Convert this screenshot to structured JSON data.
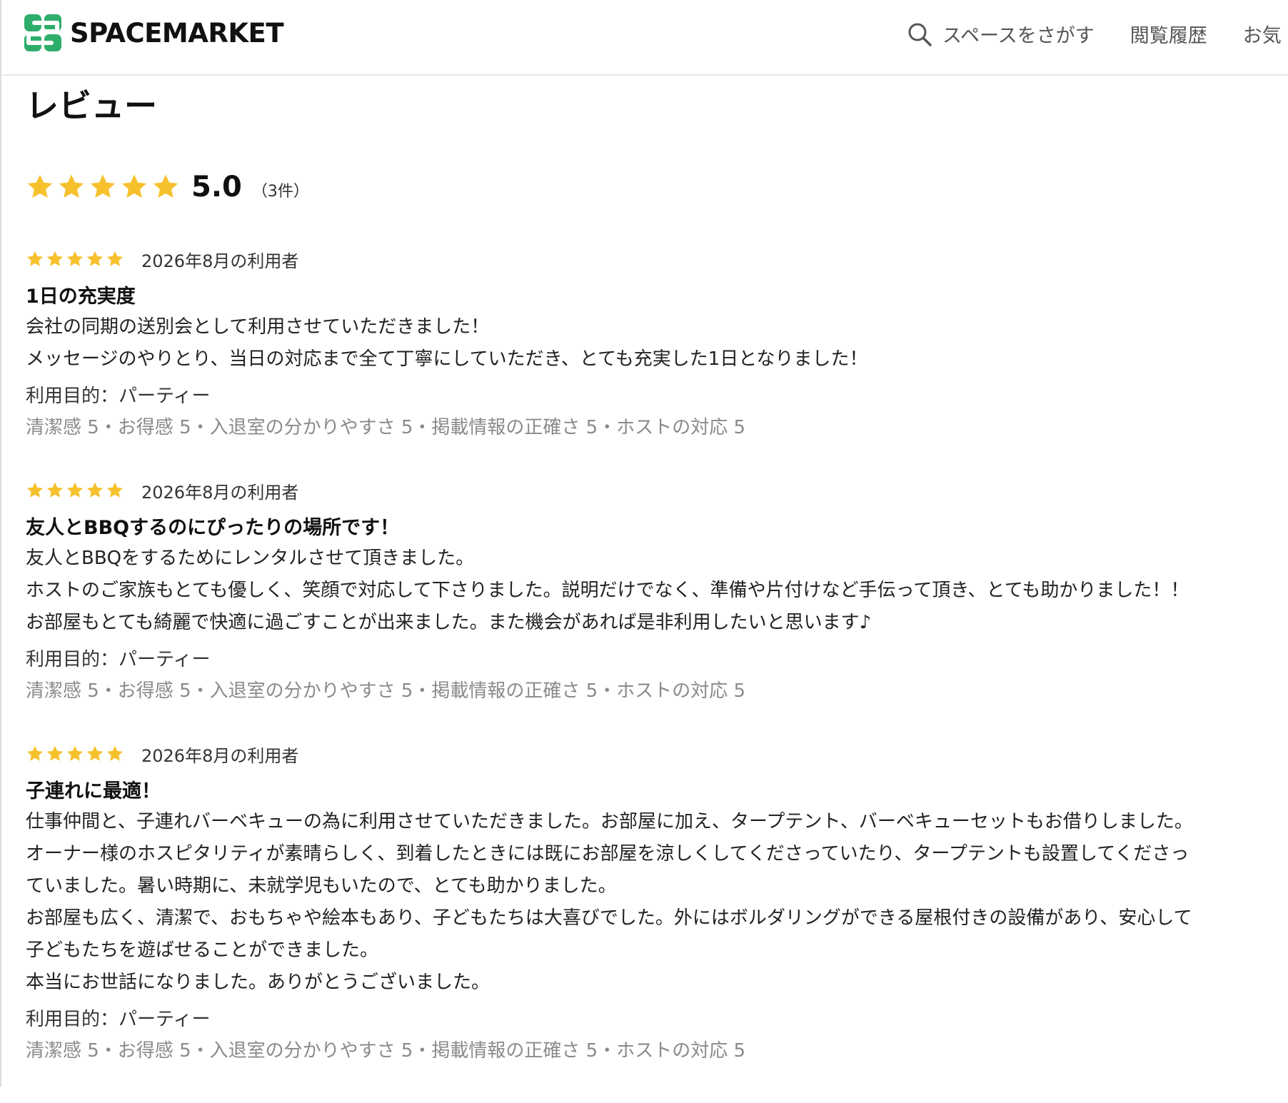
{
  "header": {
    "logo_text": "SPACEMARKET",
    "nav": {
      "search_label": "スペースをさがす",
      "history_label": "閲覧履歴",
      "favorites_label": "お気"
    }
  },
  "colors": {
    "star": "#F7C12E",
    "logo_green": "#2EAD6B",
    "logo_dark": "#1F6B45"
  },
  "page": {
    "title": "レビュー"
  },
  "summary": {
    "stars": 5,
    "score": "5.0",
    "count": "（3件）"
  },
  "reviews": [
    {
      "stars": 5,
      "date": "2026年8月の利用者",
      "title": "1日の充実度",
      "body": "会社の同期の送別会として利用させていただきました！\nメッセージのやりとり、当日の対応まで全て丁寧にしていただき、とても充実した1日となりました！",
      "purpose": "利用目的：パーティー",
      "ratings": "清潔感 5・お得感 5・入退室の分かりやすさ 5・掲載情報の正確さ 5・ホストの対応 5"
    },
    {
      "stars": 5,
      "date": "2026年8月の利用者",
      "title": "友人とBBQするのにぴったりの場所です！",
      "body": "友人とBBQをするためにレンタルさせて頂きました。\nホストのご家族もとても優しく、笑顔で対応して下さりました。説明だけでなく、準備や片付けなど手伝って頂き、とても助かりました！！お部屋もとても綺麗で快適に過ごすことが出来ました。また機会があれば是非利用したいと思います♪",
      "purpose": "利用目的：パーティー",
      "ratings": "清潔感 5・お得感 5・入退室の分かりやすさ 5・掲載情報の正確さ 5・ホストの対応 5"
    },
    {
      "stars": 5,
      "date": "2026年8月の利用者",
      "title": "子連れに最適！",
      "body": "仕事仲間と、子連れバーベキューの為に利用させていただきました。お部屋に加え、タープテント、バーベキューセットもお借りしました。\nオーナー様のホスピタリティが素晴らしく、到着したときには既にお部屋を涼しくしてくださっていたり、タープテントも設置してくださっていました。暑い時期に、未就学児もいたので、とても助かりました。\nお部屋も広く、清潔で、おもちゃや絵本もあり、子どもたちは大喜びでした。外にはボルダリングができる屋根付きの設備があり、安心して子どもたちを遊ばせることができました。\n本当にお世話になりました。ありがとうございました。",
      "purpose": "利用目的：パーティー",
      "ratings": "清潔感 5・お得感 5・入退室の分かりやすさ 5・掲載情報の正確さ 5・ホストの対応 5"
    }
  ]
}
